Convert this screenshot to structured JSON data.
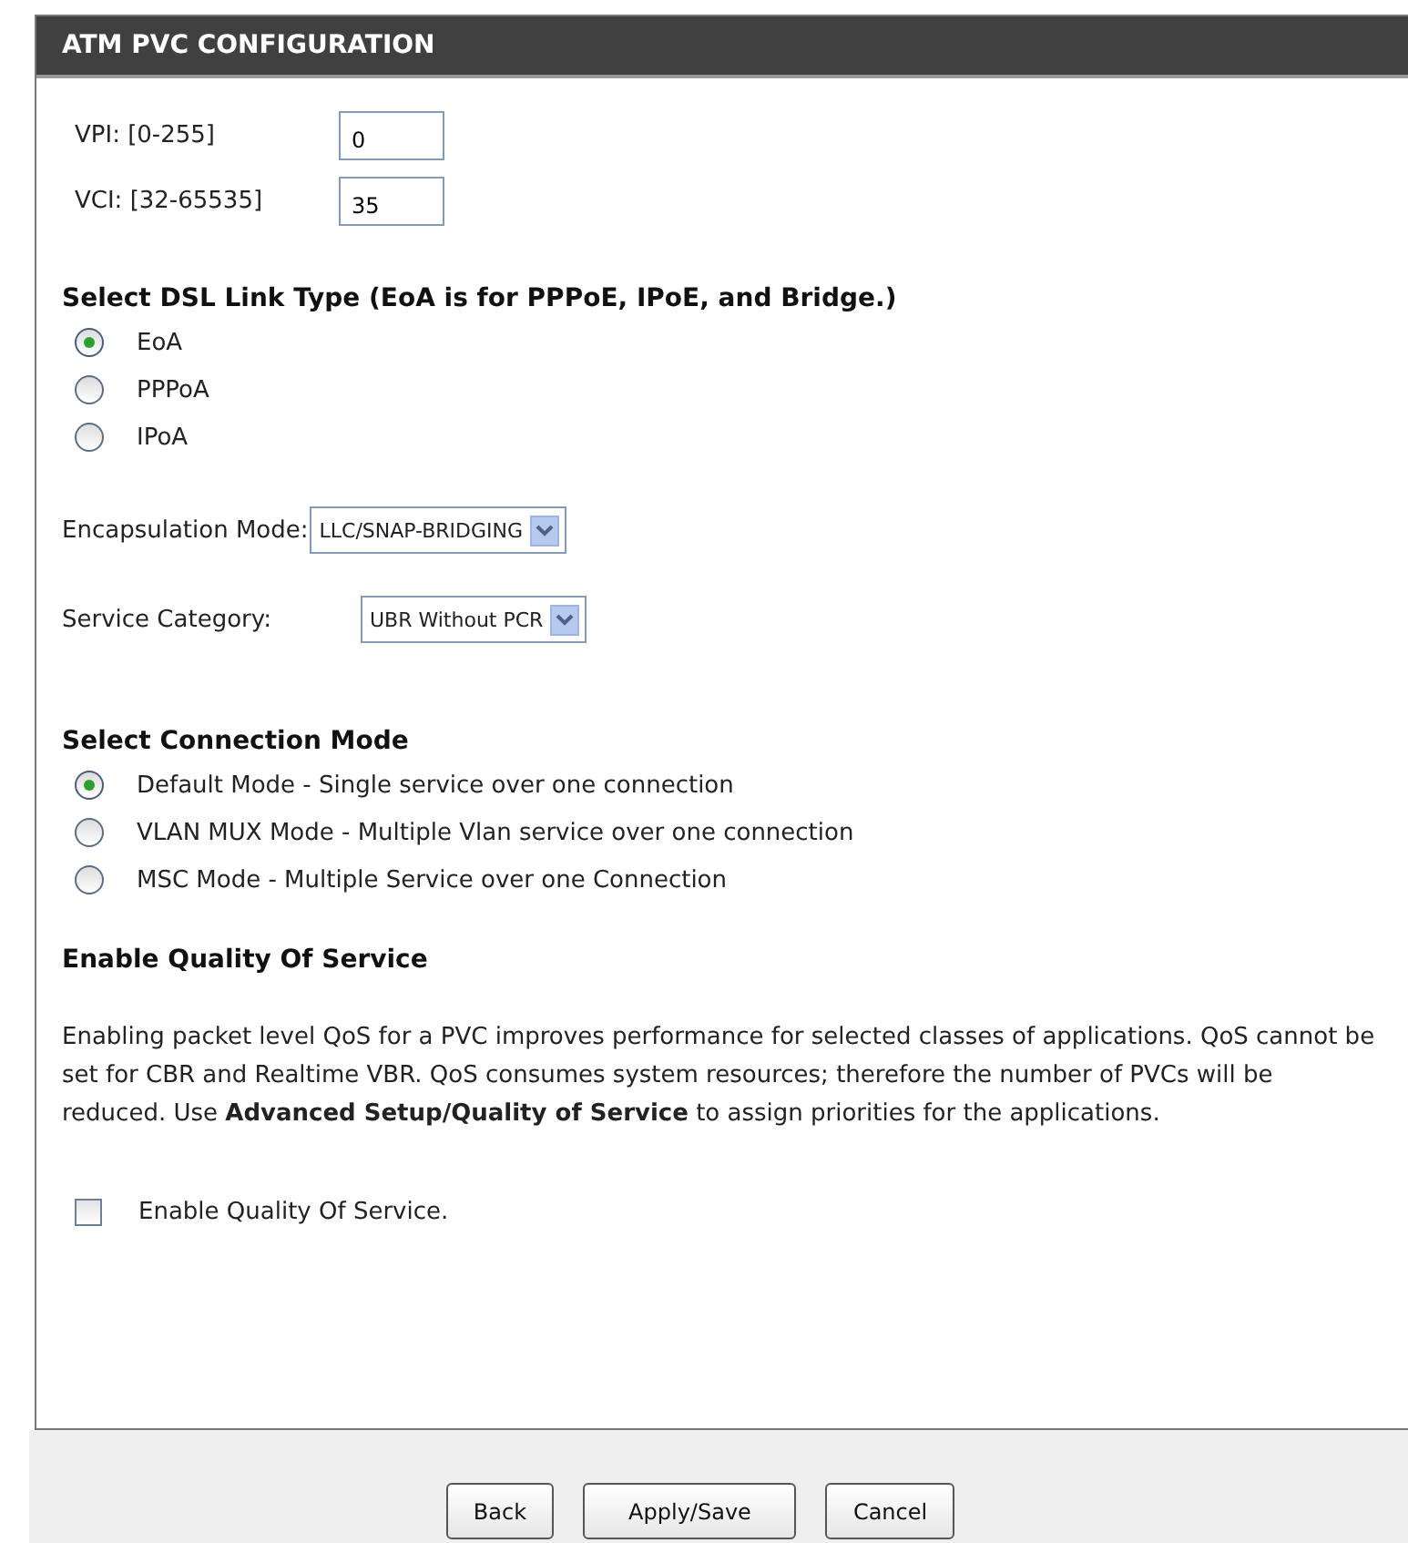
{
  "panel": {
    "title": "ATM PVC CONFIGURATION"
  },
  "fields": [
    {
      "label": "VPI: [0-255]",
      "value": "0"
    },
    {
      "label": "VCI: [32-65535]",
      "value": "35"
    }
  ],
  "link_type": {
    "heading": "Select DSL Link Type (EoA is for PPPoE, IPoE, and Bridge.)",
    "options": [
      {
        "label": "EoA",
        "selected": true
      },
      {
        "label": "PPPoA",
        "selected": false
      },
      {
        "label": "IPoA",
        "selected": false
      }
    ]
  },
  "selects": [
    {
      "label": "Encapsulation Mode:",
      "value": "LLC/SNAP-BRIDGING"
    },
    {
      "label": "Service Category:",
      "value": "UBR Without PCR"
    }
  ],
  "connection_mode": {
    "heading": "Select Connection Mode",
    "options": [
      {
        "label": "Default Mode - Single service over one connection",
        "selected": true
      },
      {
        "label": "VLAN MUX Mode - Multiple Vlan service over one connection",
        "selected": false
      },
      {
        "label": "MSC Mode - Multiple Service over one Connection",
        "selected": false
      }
    ]
  },
  "qos": {
    "heading": "Enable Quality Of Service",
    "description": "Enabling packet level QoS for a PVC improves performance for selected classes of applications.  QoS cannot be set for CBR and Realtime VBR.  QoS consumes system resources; therefore the number of PVCs will be reduced. Use **Advanced Setup/Quality of Service** to assign priorities for the applications.",
    "checkbox": {
      "label": "Enable Quality Of Service.",
      "checked": false
    }
  },
  "buttons": [
    "Back",
    "Apply/Save",
    "Cancel"
  ]
}
